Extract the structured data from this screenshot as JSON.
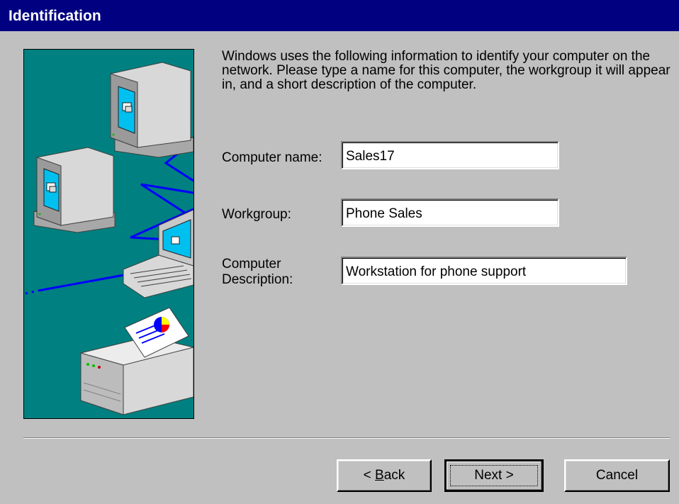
{
  "dialog": {
    "title": "Identification",
    "intro": "Windows uses the following information to identify your computer on the network.  Please type a name for this computer, the workgroup it will appear in, and a short description of the computer."
  },
  "form": {
    "computer_name": {
      "label": "Computer name:",
      "value": "Sales17"
    },
    "workgroup": {
      "label": "Workgroup:",
      "value": "Phone Sales"
    },
    "description": {
      "label_line1": "Computer",
      "label_line2": "Description:",
      "value": "Workstation for phone support"
    }
  },
  "buttons": {
    "back_prefix": "< ",
    "back_accel": "B",
    "back_rest": "ack",
    "next": "Next >",
    "cancel": "Cancel"
  },
  "colors": {
    "title_bar": "#000080",
    "dialog_face": "#c0c0c0",
    "illustration_bg": "#008080",
    "network_lines": "#0000ff"
  }
}
